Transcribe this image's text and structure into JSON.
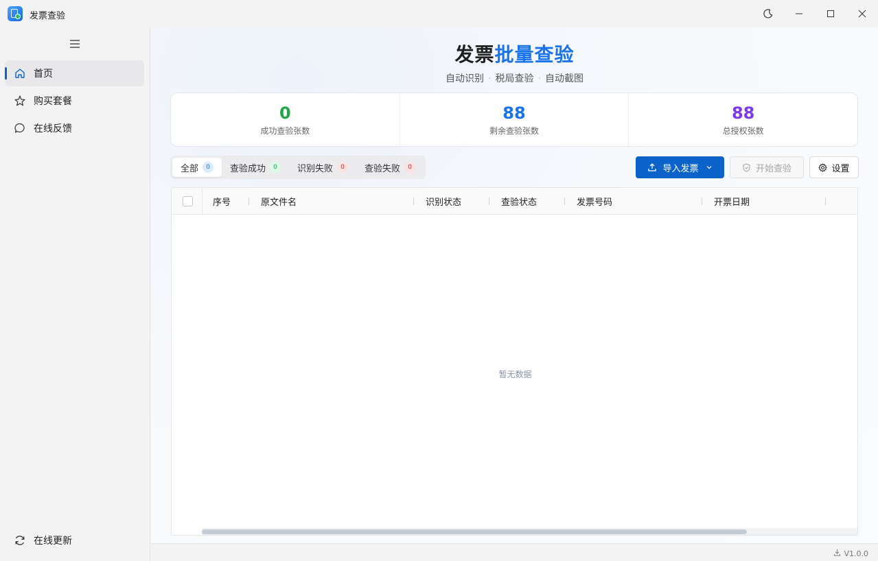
{
  "window": {
    "title": "发票查验",
    "controls": [
      "theme-toggle",
      "minimize",
      "maximize",
      "close"
    ]
  },
  "sidebar": {
    "items": [
      {
        "label": "首页",
        "icon": "home-icon",
        "active": true
      },
      {
        "label": "购买套餐",
        "icon": "star-icon",
        "active": false
      },
      {
        "label": "在线反馈",
        "icon": "chat-bubble-icon",
        "active": false
      }
    ],
    "bottom": {
      "label": "在线更新",
      "icon": "refresh-icon"
    }
  },
  "header": {
    "title_part1": "发票",
    "title_part2": "批量查验",
    "features": [
      "自动识别",
      "税局查验",
      "自动截图"
    ]
  },
  "stats": [
    {
      "value": "0",
      "label": "成功查验张数",
      "color": "#22a547"
    },
    {
      "value": "88",
      "label": "剩余查验张数",
      "color": "#1a73e8"
    },
    {
      "value": "88",
      "label": "总授权张数",
      "color": "#7c3aed"
    }
  ],
  "tabs": [
    {
      "label": "全部",
      "count": "0",
      "badge_bg": "#dbeafe",
      "badge_fg": "#1a73e8",
      "active": true
    },
    {
      "label": "查验成功",
      "count": "0",
      "badge_bg": "#dcfce7",
      "badge_fg": "#16a34a",
      "active": false
    },
    {
      "label": "识别失败",
      "count": "0",
      "badge_bg": "#fee2e2",
      "badge_fg": "#dc2626",
      "active": false
    },
    {
      "label": "查验失败",
      "count": "0",
      "badge_bg": "#fee2e2",
      "badge_fg": "#dc2626",
      "active": false
    }
  ],
  "toolbar": {
    "import_label": "导入发票",
    "start_label": "开始查验",
    "settings_label": "设置"
  },
  "table": {
    "columns": [
      "序号",
      "原文件名",
      "识别状态",
      "查验状态",
      "发票号码",
      "开票日期"
    ],
    "empty_text": "暂无数据"
  },
  "status": {
    "version": "V1.0.0"
  },
  "colors": {
    "accent": "#0b63c9",
    "title_highlight": "#1a73e8"
  }
}
